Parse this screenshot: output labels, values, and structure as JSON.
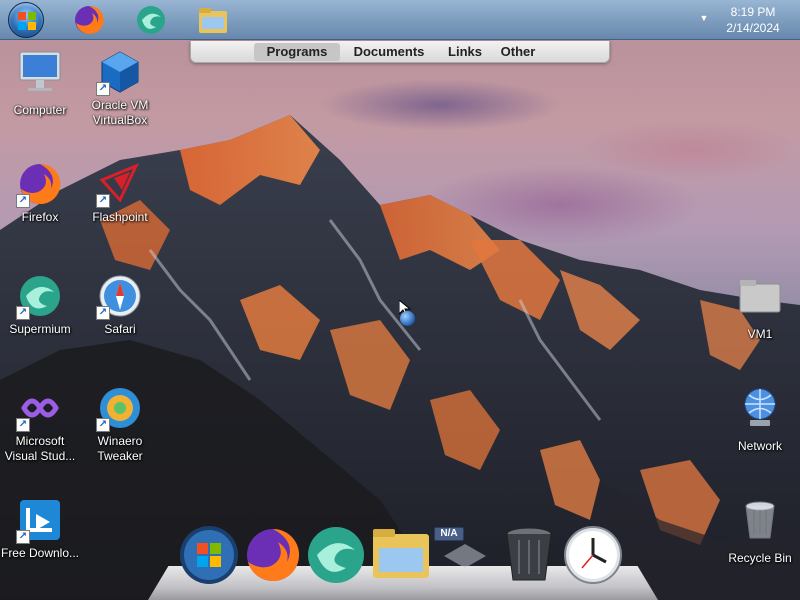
{
  "taskbar": {
    "apps": [
      {
        "name": "Firefox",
        "icon": "firefox-icon"
      },
      {
        "name": "Supermium",
        "icon": "supermium-icon"
      },
      {
        "name": "File Explorer",
        "icon": "folder-icon"
      }
    ],
    "clock": {
      "time": "8:19 PM",
      "date": "2/14/2024"
    },
    "tray_arrow": "▼"
  },
  "menubar": {
    "items": [
      "Programs",
      "Documents",
      "Links",
      "Other"
    ],
    "active": "Programs"
  },
  "desktop": {
    "left_icons": [
      {
        "label": "Computer",
        "icon": "computer-icon"
      },
      {
        "label": "Oracle VM VirtualBox",
        "icon": "virtualbox-icon"
      },
      {
        "label": "Firefox",
        "icon": "firefox-icon"
      },
      {
        "label": "Flashpoint",
        "icon": "flashpoint-icon"
      },
      {
        "label": "Supermium",
        "icon": "supermium-icon"
      },
      {
        "label": "Safari",
        "icon": "safari-icon"
      },
      {
        "label": "Microsoft Visual Stud...",
        "icon": "visual-studio-icon"
      },
      {
        "label": "Winaero Tweaker",
        "icon": "winaero-icon"
      },
      {
        "label": "Free Downlo...",
        "icon": "download-icon"
      }
    ],
    "right_icons": [
      {
        "label": "VM1",
        "icon": "folder-icon"
      },
      {
        "label": "Network",
        "icon": "network-icon"
      },
      {
        "label": "Recycle Bin",
        "icon": "recycle-bin-icon"
      }
    ]
  },
  "dock": {
    "items": [
      "Start",
      "Firefox",
      "Supermium",
      "File Explorer",
      "N/A",
      "Recycle Bin",
      "Clock"
    ],
    "na_badge": "N/A"
  },
  "colors": {
    "taskbar": "#7aa3c9",
    "accent": "#2f6fb5",
    "label": "#ffffff"
  }
}
